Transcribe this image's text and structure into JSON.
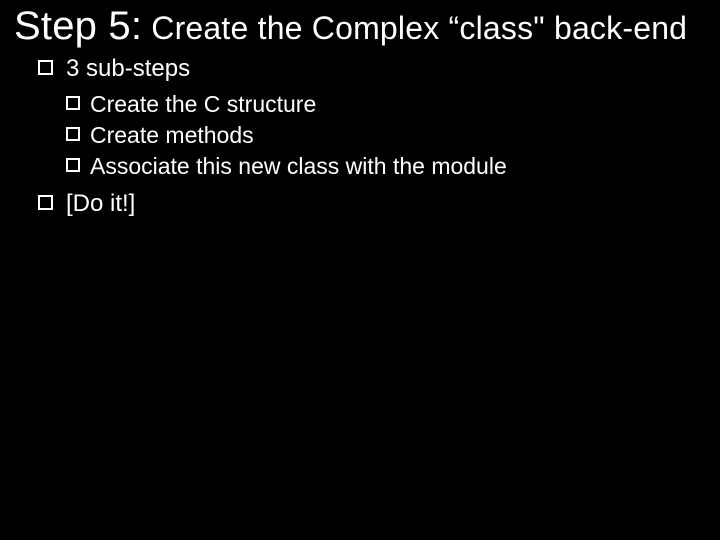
{
  "title": {
    "step_prefix": "Step 5:",
    "rest": " Create the Complex “class\" back-end"
  },
  "bullets": {
    "item1": "3 sub-steps",
    "sub1": "Create the C structure",
    "sub2": "Create methods",
    "sub3": "Associate this new class with the module",
    "item2": "[Do it!]"
  }
}
